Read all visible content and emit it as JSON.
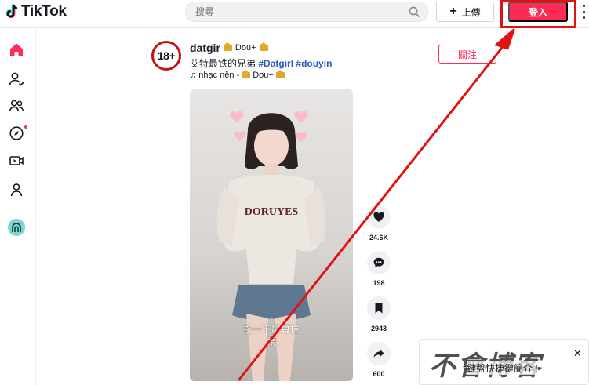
{
  "app": {
    "name": "TikTok"
  },
  "header": {
    "logo_text": "TikTok",
    "search_placeholder": "搜尋",
    "upload_label": "上傳",
    "login_label": "登入"
  },
  "sidebar": {
    "items": [
      {
        "name": "home",
        "icon": "home-icon",
        "active": true
      },
      {
        "name": "following",
        "icon": "user-follow-icon"
      },
      {
        "name": "friends",
        "icon": "friends-icon"
      },
      {
        "name": "explore",
        "icon": "compass-icon",
        "badge": true
      },
      {
        "name": "live",
        "icon": "live-video-icon"
      },
      {
        "name": "profile",
        "icon": "profile-icon"
      },
      {
        "name": "live-channel",
        "icon": "live-channel-icon"
      }
    ]
  },
  "post": {
    "avatar_badge": "18+",
    "author": "datgir",
    "author_tag": "Dou+",
    "caption_text": "艾特最铁的兄弟",
    "hashtags": [
      "#Datgirl",
      "#douyin"
    ],
    "music": "nhạc nền - 👑 Dou+ 👑",
    "music_label": "nhạc nền -",
    "music_tag": "Dou+",
    "follow_label": "關注",
    "video_hint": "按一下屏幕檢\n視",
    "actions": {
      "likes": "24.6K",
      "comments": "198",
      "saves": "2943",
      "shares": "600"
    }
  },
  "overlay": {
    "watermark_logo": "不會博客",
    "watermark_text": "鍵盤快捷鍵簡介 !",
    "watermark_close": "✕"
  },
  "colors": {
    "brand": "#fe2c55",
    "annotation": "#e31212",
    "hashtag": "#2b5db9",
    "crown": "#e3a72a"
  }
}
